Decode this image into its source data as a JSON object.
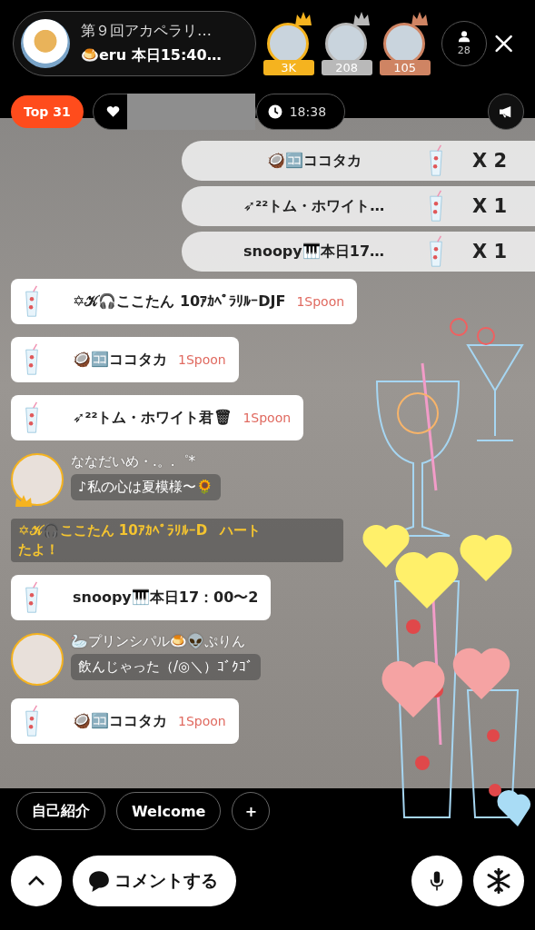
{
  "header": {
    "title": "第９回アカペラリ…",
    "subtitle": "🍮eru 本日15:40…"
  },
  "top_listeners": [
    {
      "count": "3K",
      "color": "#f5b31f"
    },
    {
      "count": "208",
      "color": "#b9b9b9"
    },
    {
      "count": "105",
      "color": "#cf8463"
    }
  ],
  "listener_count": "28",
  "rank_badge": "Top 31",
  "timer": "18:38",
  "gift_combos": [
    {
      "sender": "🥥🈁ココタカ",
      "multiplier": "X 2"
    },
    {
      "sender": "➶²²トム・ホワイト…",
      "multiplier": "X 1"
    },
    {
      "sender": "snoopy🎹本日17…",
      "multiplier": "X 1"
    }
  ],
  "chat": [
    {
      "kind": "gift",
      "sender": "✡𝒦🎧ここたん 10ｱｶﾍﾟﾗﾘﾙｰDJF",
      "amount": "1Spoon"
    },
    {
      "kind": "gift",
      "sender": "🥥🈁ココタカ",
      "amount": "1Spoon"
    },
    {
      "kind": "gift",
      "sender": "➶²²トム・ホワイト君🗑",
      "amount": "1Spoon"
    },
    {
      "kind": "comment",
      "name": "ななだいめ・.。.゜*",
      "text": "♪私の心は夏模様〜🌻",
      "crown": true
    },
    {
      "kind": "system",
      "parts": [
        "✡𝒦🎧ここたん 10ｱｶﾍﾟﾗﾘﾙｰD",
        "ハート",
        "たよ！"
      ]
    },
    {
      "kind": "gift",
      "sender": "snoopy🎹本日17：00〜2"
    },
    {
      "kind": "comment",
      "name": "🦢プリンシパル🍮👽ぷりん",
      "text": "飲んじゃった（/◎＼）ｺﾞｸｺﾞ",
      "crown": false
    },
    {
      "kind": "gift",
      "sender": "🥥🈁ココタカ",
      "amount": "1Spoon"
    }
  ],
  "quick_replies": [
    "自己紹介",
    "Welcome",
    "+"
  ],
  "comment_button": "コメントする"
}
